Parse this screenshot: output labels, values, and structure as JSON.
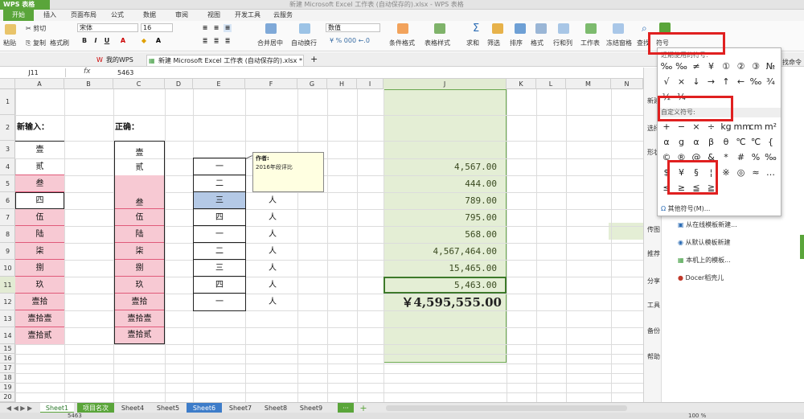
{
  "app": {
    "logo": "WPS 表格",
    "title": "新建 Microsoft Excel 工作表 (自动保存的).xlsx - WPS 表格"
  },
  "menu": [
    "开始",
    "插入",
    "页面布局",
    "公式",
    "数据",
    "审阅",
    "视图",
    "开发工具",
    "云服务"
  ],
  "ribbon": {
    "cut": "剪切",
    "paste": "粘贴",
    "copy": "复制",
    "format_painter": "格式刷",
    "font": "宋体",
    "size": "16",
    "number_format": "数值",
    "merge": "合并居中",
    "wrap": "自动换行",
    "cond_format": "条件格式",
    "table_style": "表格样式",
    "sum": "求和",
    "filter": "筛选",
    "sort": "排序",
    "format": "格式",
    "rowcol": "行和列",
    "sheet": "工作表",
    "freeze": "冻结窗格",
    "find": "查找",
    "symbol": "符号"
  },
  "doc_tabs": [
    "我的WPS",
    "新建 Microsoft Excel 工作表 (自动保存的).xlsx *"
  ],
  "formula": {
    "cell_ref": "J11",
    "fx": "fx",
    "value": "5463"
  },
  "columns": [
    "A",
    "B",
    "C",
    "D",
    "E",
    "F",
    "G",
    "H",
    "I",
    "J",
    "K",
    "L",
    "M",
    "N"
  ],
  "rows": [
    "1",
    "2",
    "3",
    "4",
    "5",
    "6",
    "7",
    "8",
    "9",
    "10",
    "11",
    "12",
    "13",
    "14",
    "15",
    "16",
    "17",
    "18",
    "19",
    "20"
  ],
  "cells": {
    "a2": "新输入：",
    "c2": "正确：",
    "a": [
      "壹",
      "贰",
      "叁",
      "四",
      "伍",
      "陆",
      "柒",
      "捌",
      "玖",
      "壹拾",
      "壹拾壹",
      "壹拾贰"
    ],
    "c": [
      "壹",
      "贰",
      "",
      "叁",
      "伍",
      "陆",
      "柒",
      "捌",
      "玖",
      "壹拾",
      "壹拾壹",
      "壹拾贰"
    ],
    "e": [
      "一",
      "二",
      "三",
      "四",
      "一",
      "二",
      "三",
      "四",
      "一"
    ],
    "f": [
      "人",
      "人",
      "人",
      "人",
      "人",
      "人",
      "人",
      "人"
    ],
    "j": [
      "4,567.00",
      "444.00",
      "789.00",
      "795.00",
      "568.00",
      "4,567,464.00",
      "15,465.00",
      "5,463.00"
    ],
    "j_total": "￥4,595,555.00"
  },
  "comment": {
    "author": "作者:",
    "text": "2016年段评比"
  },
  "sheets": [
    "Sheet1",
    "项目名次",
    "Sheet4",
    "Sheet5",
    "Sheet6",
    "Sheet7",
    "Sheet8",
    "Sheet9"
  ],
  "status": {
    "value": "5463",
    "zoom": "100 %"
  },
  "symbols": {
    "recent_label": "近期使用的符号:",
    "recent": [
      "‰",
      "‰",
      "≠",
      "¥",
      "①",
      "②",
      "③",
      "№",
      "√",
      "×",
      "↓",
      "→",
      "↑",
      "←",
      "‰",
      "¾",
      "½",
      "¼"
    ],
    "custom_label": "自定义符号:",
    "custom": [
      "+",
      "−",
      "×",
      "÷",
      "kg",
      "mm",
      "cm",
      "m²",
      "α",
      "g",
      "α",
      "β",
      "θ",
      "℃",
      "℃",
      "{",
      "©",
      "®",
      "@",
      "&",
      "*",
      "#",
      "%",
      "‰",
      "$",
      "¥",
      "§",
      "¦",
      "※",
      "◎",
      "≈",
      "…",
      "≤",
      "≥",
      "≦",
      "≧"
    ],
    "more": "其他符号(M)..."
  },
  "taskpane": {
    "items": [
      "从在线模板新建...",
      "从默认模板新建",
      "本机上的模板...",
      "Docer稻壳儿"
    ],
    "side": [
      "新建",
      "选择",
      "形状",
      "传图",
      "推荐",
      "分享",
      "工具",
      "备份",
      "帮助"
    ],
    "find_more": "找命令"
  }
}
